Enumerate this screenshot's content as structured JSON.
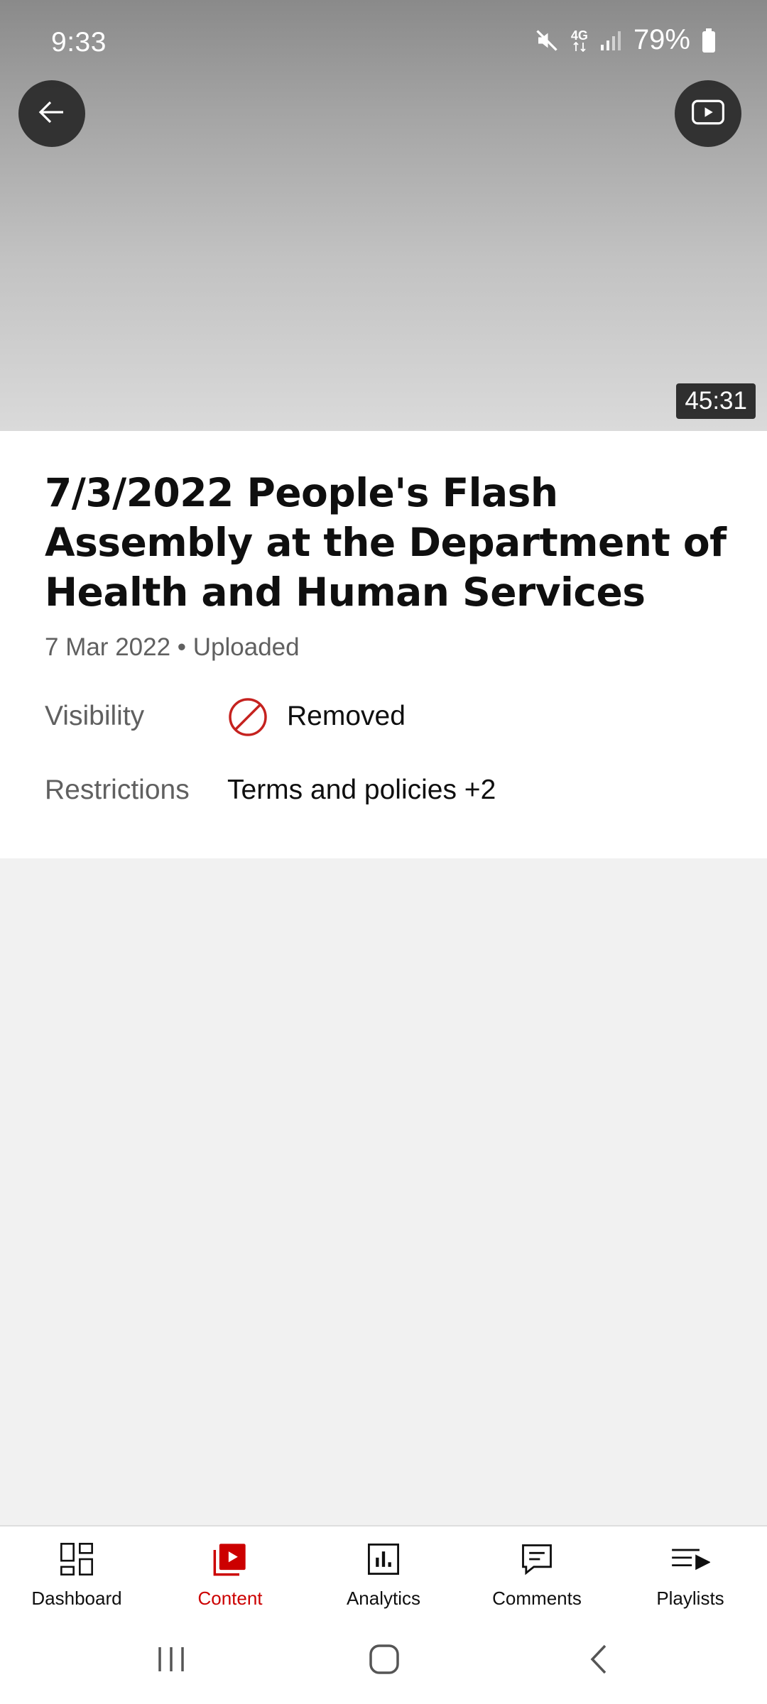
{
  "status_bar": {
    "time": "9:33",
    "network": "4G",
    "battery": "79%"
  },
  "video": {
    "duration": "45:31",
    "title": "7/3/2022 People's Flash Assembly at the Department of Health and Human Services",
    "meta": "7 Mar 2022 • Uploaded",
    "visibility_label": "Visibility",
    "visibility_value": "Removed",
    "visibility_icon": "removed-icon",
    "restrictions_label": "Restrictions",
    "restrictions_value": "Terms and policies +2"
  },
  "bottom_nav": {
    "items": [
      {
        "label": "Dashboard",
        "icon": "dashboard-icon",
        "active": false
      },
      {
        "label": "Content",
        "icon": "content-icon",
        "active": true
      },
      {
        "label": "Analytics",
        "icon": "analytics-icon",
        "active": false
      },
      {
        "label": "Comments",
        "icon": "comments-icon",
        "active": false
      },
      {
        "label": "Playlists",
        "icon": "playlists-icon",
        "active": false
      }
    ]
  },
  "colors": {
    "accent": "#cc0000",
    "removed": "#c5221f",
    "text_primary": "#0f0f0f",
    "text_secondary": "#606060"
  }
}
